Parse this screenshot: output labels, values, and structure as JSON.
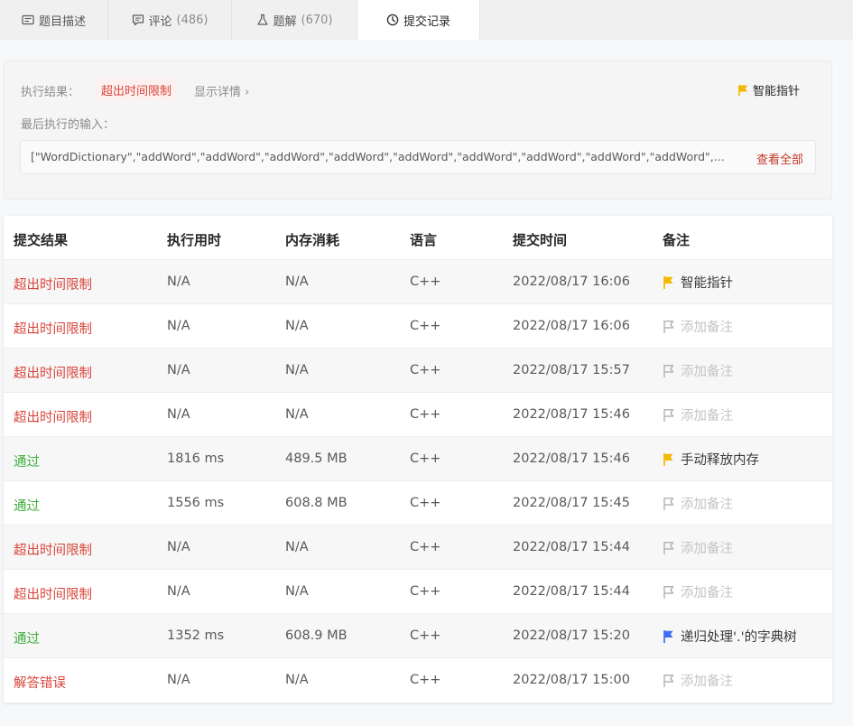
{
  "tabs": [
    {
      "label": "题目描述",
      "count": "",
      "icon": "description-icon"
    },
    {
      "label": "评论",
      "count": "(486)",
      "icon": "comment-icon"
    },
    {
      "label": "题解",
      "count": "(670)",
      "icon": "flask-icon"
    },
    {
      "label": "提交记录",
      "count": "",
      "icon": "clock-icon"
    }
  ],
  "result": {
    "label": "执行结果：",
    "status": "超出时间限制",
    "detail": "显示详情 ›",
    "hint": "智能指针",
    "input_label": "最后执行的输入：",
    "input_value": "[\"WordDictionary\",\"addWord\",\"addWord\",\"addWord\",\"addWord\",\"addWord\",\"addWord\",\"addWord\",\"addWord\",\"addWord\",...",
    "view_all": "查看全部"
  },
  "table": {
    "headers": [
      "提交结果",
      "执行用时",
      "内存消耗",
      "语言",
      "提交时间",
      "备注"
    ],
    "rows": [
      {
        "status": "超出时间限制",
        "ok": false,
        "time": "N/A",
        "memory": "N/A",
        "lang": "C++",
        "date": "2022/08/17 16:06",
        "note": "智能指针",
        "flag": "yellow"
      },
      {
        "status": "超出时间限制",
        "ok": false,
        "time": "N/A",
        "memory": "N/A",
        "lang": "C++",
        "date": "2022/08/17 16:06",
        "note": "添加备注",
        "flag": "empty"
      },
      {
        "status": "超出时间限制",
        "ok": false,
        "time": "N/A",
        "memory": "N/A",
        "lang": "C++",
        "date": "2022/08/17 15:57",
        "note": "添加备注",
        "flag": "empty"
      },
      {
        "status": "超出时间限制",
        "ok": false,
        "time": "N/A",
        "memory": "N/A",
        "lang": "C++",
        "date": "2022/08/17 15:46",
        "note": "添加备注",
        "flag": "empty"
      },
      {
        "status": "通过",
        "ok": true,
        "time": "1816 ms",
        "memory": "489.5 MB",
        "lang": "C++",
        "date": "2022/08/17 15:46",
        "note": "手动释放内存",
        "flag": "yellow"
      },
      {
        "status": "通过",
        "ok": true,
        "time": "1556 ms",
        "memory": "608.8 MB",
        "lang": "C++",
        "date": "2022/08/17 15:45",
        "note": "添加备注",
        "flag": "empty"
      },
      {
        "status": "超出时间限制",
        "ok": false,
        "time": "N/A",
        "memory": "N/A",
        "lang": "C++",
        "date": "2022/08/17 15:44",
        "note": "添加备注",
        "flag": "empty"
      },
      {
        "status": "超出时间限制",
        "ok": false,
        "time": "N/A",
        "memory": "N/A",
        "lang": "C++",
        "date": "2022/08/17 15:44",
        "note": "添加备注",
        "flag": "empty"
      },
      {
        "status": "通过",
        "ok": true,
        "time": "1352 ms",
        "memory": "608.9 MB",
        "lang": "C++",
        "date": "2022/08/17 15:20",
        "note": "递归处理'.'的字典树",
        "flag": "blue"
      },
      {
        "status": "解答错误",
        "ok": false,
        "time": "N/A",
        "memory": "N/A",
        "lang": "C++",
        "date": "2022/08/17 15:00",
        "note": "添加备注",
        "flag": "empty"
      }
    ]
  },
  "colors": {
    "fail": "#d9453b",
    "ok": "#3cae3c",
    "flag_yellow": "#f5b800",
    "flag_blue": "#3d6ef5",
    "flag_empty": "#b5b5b5"
  }
}
